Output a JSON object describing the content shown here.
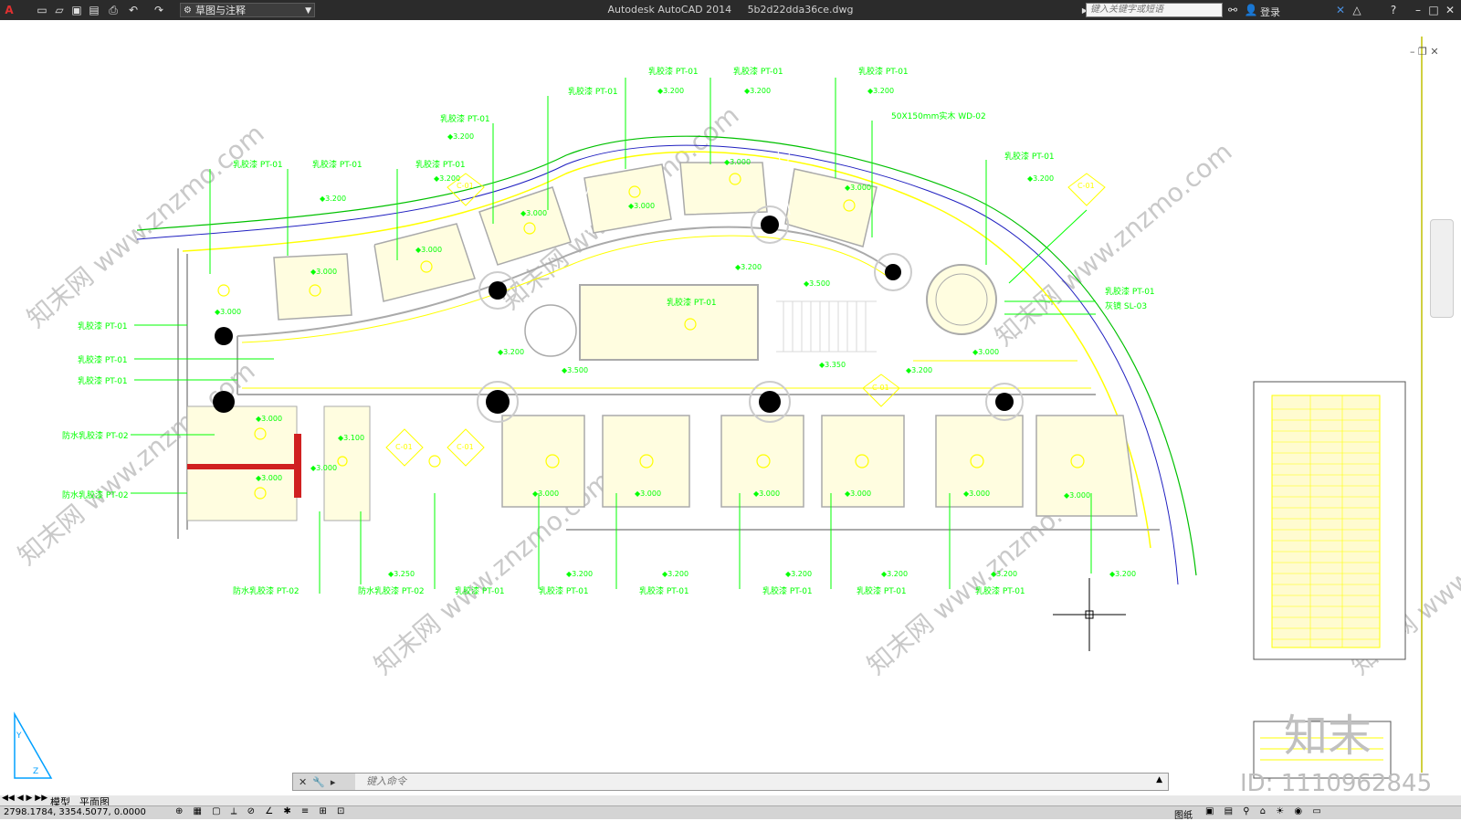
{
  "titlebar": {
    "workspace": "草图与注释",
    "app_name": "Autodesk AutoCAD 2014",
    "file_name": "5b2d22dda36ce.dwg",
    "search_placeholder": "键入关键字或短语",
    "login": "登录",
    "icons": [
      "autocad-logo-icon",
      "new-icon",
      "open-icon",
      "save-icon",
      "saveas-icon",
      "print-icon",
      "undo-icon",
      "redo-icon",
      "search-icon",
      "user-icon",
      "exchange-icon",
      "help-icon",
      "minimize-icon",
      "maximize-icon",
      "close-icon"
    ]
  },
  "drawing": {
    "labels": {
      "latex": "乳胶漆",
      "latex_code": "PT-01",
      "waterproof": "防水乳胶漆",
      "waterproof_code": "PT-02",
      "wood": "50X150mm实木",
      "wood_code": "WD-02",
      "gray_glass": "灰镜",
      "gray_glass_code": "SL-03"
    },
    "elevations": [
      "3.200",
      "3.000",
      "3.100",
      "3.250",
      "3.500",
      "3.350"
    ],
    "section_marks": [
      "C-01",
      "DC-01"
    ]
  },
  "watermark": {
    "site": "知末网 www.znzmo.com",
    "brand": "知末",
    "id": "ID: 1110962845"
  },
  "command": {
    "placeholder": "键入命令"
  },
  "tabs": {
    "model": "模型",
    "layout": "平面图"
  },
  "status": {
    "coords": "2798.1784, 3354.5077, 0.0000",
    "paper": "图纸"
  }
}
